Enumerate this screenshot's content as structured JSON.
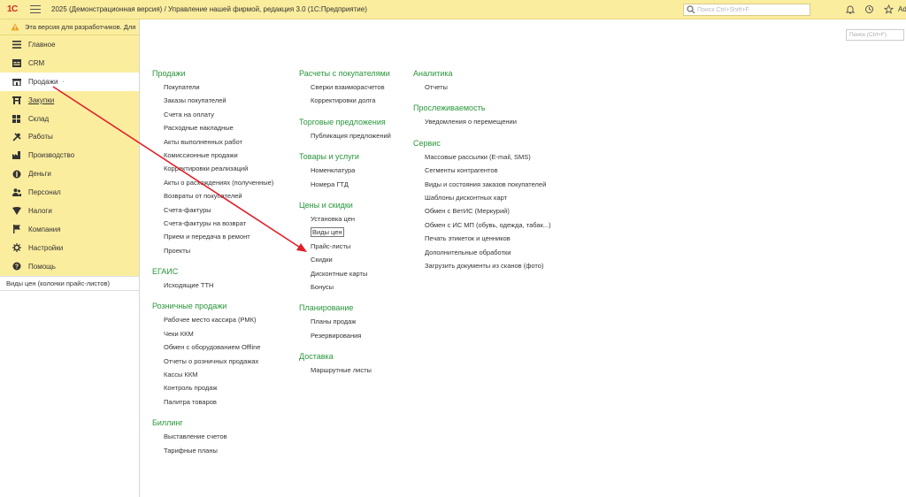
{
  "titlebar": {
    "logo": "1С",
    "title": "2025 (Демонстрационная версия) / Управление нашей фирмой, редакция 3.0  (1С:Предприятие)",
    "search_placeholder": "Поиск Ctrl+Shift+F",
    "user_truncated": "Ad",
    "icons": [
      "bell-icon",
      "history-icon",
      "star-icon"
    ]
  },
  "sidebar": {
    "dev_warning": "Эта версия для разработчиков. Для",
    "items": [
      {
        "label": "Главное",
        "icon": "list-icon"
      },
      {
        "label": "CRM",
        "icon": "crm-icon"
      },
      {
        "label": "Продажи",
        "icon": "shop-icon",
        "active": true
      },
      {
        "label": "Закупки",
        "icon": "cart-icon"
      },
      {
        "label": "Склад",
        "icon": "warehouse-icon"
      },
      {
        "label": "Работы",
        "icon": "works-icon"
      },
      {
        "label": "Производство",
        "icon": "factory-icon"
      },
      {
        "label": "Деньги",
        "icon": "money-icon"
      },
      {
        "label": "Персонал",
        "icon": "people-icon"
      },
      {
        "label": "Налоги",
        "icon": "taxes-icon"
      },
      {
        "label": "Компания",
        "icon": "flag-icon"
      },
      {
        "label": "Настройки",
        "icon": "gear-icon"
      },
      {
        "label": "Помощь",
        "icon": "help-icon"
      }
    ],
    "open_window": "Виды цен (колонки прайс-листов)"
  },
  "main": {
    "search_placeholder": "Поиск (Ctrl+F)",
    "col1": [
      {
        "title": "Продажи",
        "items": [
          "Покупатели",
          "Заказы покупателей",
          "Счета на оплату",
          "Расходные накладные",
          "Акты выполненных работ",
          "Комиссионные продажи",
          "Корректировки реализаций",
          "Акты о расхождениях (полученные)",
          "Возвраты от покупателей",
          "Счета-фактуры",
          "Счета-фактуры на возврат",
          "Прием и передача в ремонт",
          "Проекты"
        ]
      },
      {
        "title": "ЕГАИС",
        "items": [
          "Исходящие ТТН"
        ]
      },
      {
        "title": "Розничные продажи",
        "items": [
          "Рабочее место кассира (РМК)",
          "Чеки ККМ",
          "Обмен с оборудованием Offline",
          "Отчеты о розничных продажах",
          "Кассы ККМ",
          "Контроль продаж",
          "Палитра товаров"
        ]
      },
      {
        "title": "Биллинг",
        "items": [
          "Выставление счетов",
          "Тарифные планы"
        ]
      }
    ],
    "col2": [
      {
        "title": "Расчеты с покупателями",
        "items": [
          "Сверки взаиморасчетов",
          "Корректировки долга"
        ]
      },
      {
        "title": "Торговые предложения",
        "items": [
          "Публикация предложений"
        ]
      },
      {
        "title": "Товары и услуги",
        "items": [
          "Номенклатура",
          "Номера ГТД"
        ]
      },
      {
        "title": "Цены и скидки",
        "items": [
          "Установка цен",
          "Виды цен",
          "Прайс-листы",
          "Скидки",
          "Дисконтные карты",
          "Бонусы"
        ]
      },
      {
        "title": "Планирование",
        "items": [
          "Планы продаж",
          "Резервирования"
        ]
      },
      {
        "title": "Доставка",
        "items": [
          "Маршрутные листы"
        ]
      }
    ],
    "col3": [
      {
        "title": "Аналитика",
        "items": [
          "Отчеты"
        ]
      },
      {
        "title": "Прослеживаемость",
        "items": [
          "Уведомления о перемещении"
        ]
      },
      {
        "title": "Сервис",
        "items": [
          "Массовые рассылки (E-mail, SMS)",
          "Сегменты контрагентов",
          "Виды и состояния заказов покупателей",
          "Шаблоны дисконтных карт",
          "Обмен с ВетИС (Меркурий)",
          "Обмен с ИС МП (обувь, одежда, табак...)",
          "Печать этикеток и ценников",
          "Дополнительные обработки",
          "Загрузить документы из сканов (фото)"
        ]
      }
    ],
    "selected_item": "Виды цен"
  },
  "colors": {
    "section_bg": "#fbed9e",
    "group_title": "#28963a",
    "arrow": "#e0202a",
    "logo": "#d6281f"
  }
}
